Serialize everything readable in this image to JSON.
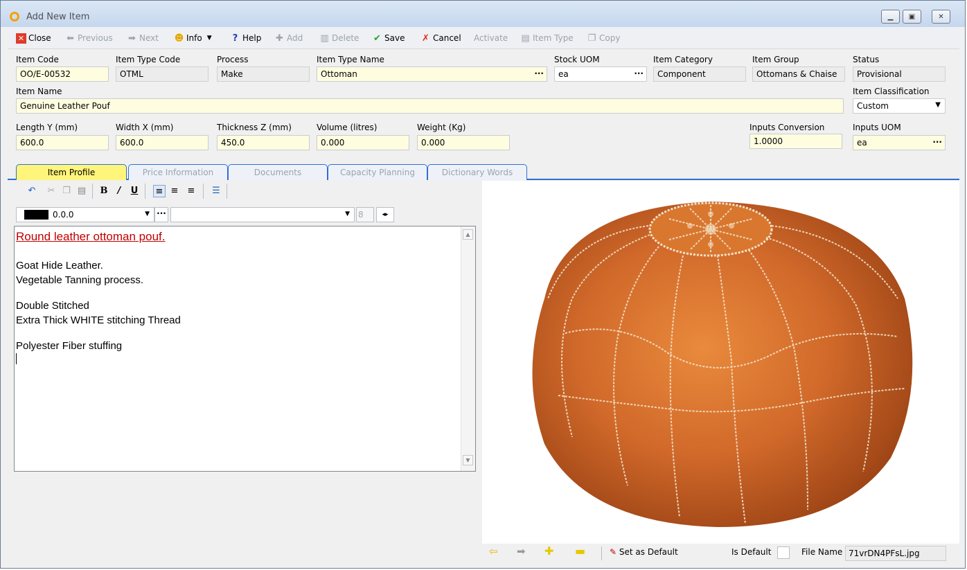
{
  "window": {
    "title": "Add New Item"
  },
  "toolbar": {
    "close": "Close",
    "previous": "Previous",
    "next": "Next",
    "info": "Info",
    "help": "Help",
    "add": "Add",
    "delete": "Delete",
    "save": "Save",
    "cancel": "Cancel",
    "activate": "Activate",
    "item_type": "Item Type",
    "copy": "Copy"
  },
  "form": {
    "item_code": {
      "label": "Item Code",
      "value": "OO/E-00532"
    },
    "item_type_code": {
      "label": "Item Type Code",
      "value": "OTML"
    },
    "process": {
      "label": "Process",
      "value": "Make"
    },
    "item_type_name": {
      "label": "Item Type Name",
      "value": "Ottoman"
    },
    "stock_uom": {
      "label": "Stock UOM",
      "value": "ea"
    },
    "item_category": {
      "label": "Item Category",
      "value": "Component"
    },
    "item_group": {
      "label": "Item Group",
      "value": "Ottomans & Chaise"
    },
    "status": {
      "label": "Status",
      "value": "Provisional"
    },
    "item_name": {
      "label": "Item Name",
      "value": "Genuine Leather Pouf"
    },
    "item_classification": {
      "label": "Item Classification",
      "value": "Custom"
    },
    "length": {
      "label": "Length Y (mm)",
      "value": "600.0"
    },
    "width": {
      "label": "Width X (mm)",
      "value": "600.0"
    },
    "thickness": {
      "label": "Thickness Z (mm)",
      "value": "450.0"
    },
    "volume": {
      "label": "Volume (litres)",
      "value": "0.000"
    },
    "weight": {
      "label": "Weight (Kg)",
      "value": "0.000"
    },
    "inputs_conversion": {
      "label": "Inputs Conversion",
      "value": "1.0000"
    },
    "inputs_uom": {
      "label": "Inputs UOM",
      "value": "ea"
    }
  },
  "tabs": [
    "Item Profile",
    "Price Information",
    "Documents",
    "Capacity Planning",
    "Dictionary Words"
  ],
  "editor": {
    "color_value": "0.0.0",
    "font_size": "8",
    "heading": "Round leather ottoman pouf.",
    "lines": [
      "Goat Hide Leather.",
      "Vegetable Tanning process.",
      "Double Stitched",
      "Extra Thick WHITE stitching Thread",
      "Polyester Fiber stuffing"
    ]
  },
  "image_bar": {
    "set_default": "Set as Default",
    "is_default": "Is Default",
    "file_name_label": "File Name",
    "file_name": "71vrDN4PFsL.jpg"
  }
}
